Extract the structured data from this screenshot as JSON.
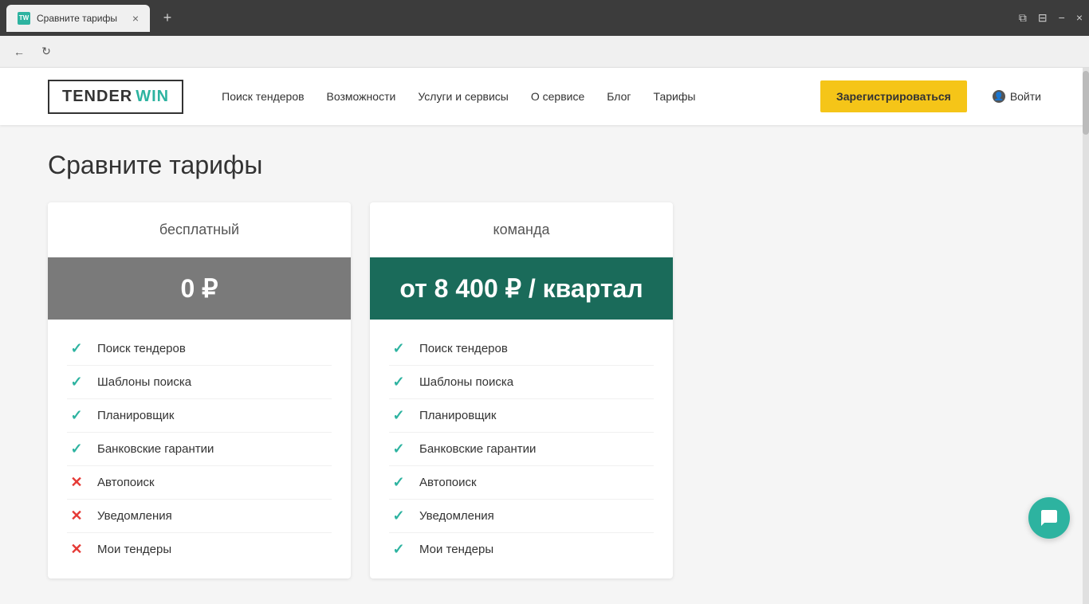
{
  "browser": {
    "tab_title": "Сравните тарифы",
    "tab_favicon": "TW",
    "close_icon": "×",
    "new_tab_icon": "+",
    "back_icon": "←",
    "refresh_icon": "↻",
    "controls": [
      "⧉",
      "⊟",
      "−",
      "×"
    ]
  },
  "navbar": {
    "logo_tender": "TENDER",
    "logo_win": "WIN",
    "links": [
      {
        "label": "Поиск тендеров"
      },
      {
        "label": "Возможности"
      },
      {
        "label": "Услуги и сервисы"
      },
      {
        "label": "О сервисе"
      },
      {
        "label": "Блог"
      },
      {
        "label": "Тарифы"
      }
    ],
    "register_btn": "Зарегистрироваться",
    "login_btn": "Войти"
  },
  "page": {
    "title": "Сравните тарифы",
    "plans": [
      {
        "name": "бесплатный",
        "price": "0 ₽",
        "price_type": "free",
        "features": [
          {
            "name": "Поиск тендеров",
            "available": true
          },
          {
            "name": "Шаблоны поиска",
            "available": true
          },
          {
            "name": "Планировщик",
            "available": true
          },
          {
            "name": "Банковские гарантии",
            "available": true
          },
          {
            "name": "Автопоиск",
            "available": false
          },
          {
            "name": "Уведомления",
            "available": false
          },
          {
            "name": "Мои тендеры",
            "available": false
          }
        ]
      },
      {
        "name": "команда",
        "price": "от 8 400 ₽ / квартал",
        "price_type": "team",
        "features": [
          {
            "name": "Поиск тендеров",
            "available": true
          },
          {
            "name": "Шаблоны поиска",
            "available": true
          },
          {
            "name": "Планировщик",
            "available": true
          },
          {
            "name": "Банковские гарантии",
            "available": true
          },
          {
            "name": "Автопоиск",
            "available": true
          },
          {
            "name": "Уведомления",
            "available": true
          },
          {
            "name": "Мои тендеры",
            "available": true
          }
        ]
      }
    ]
  }
}
